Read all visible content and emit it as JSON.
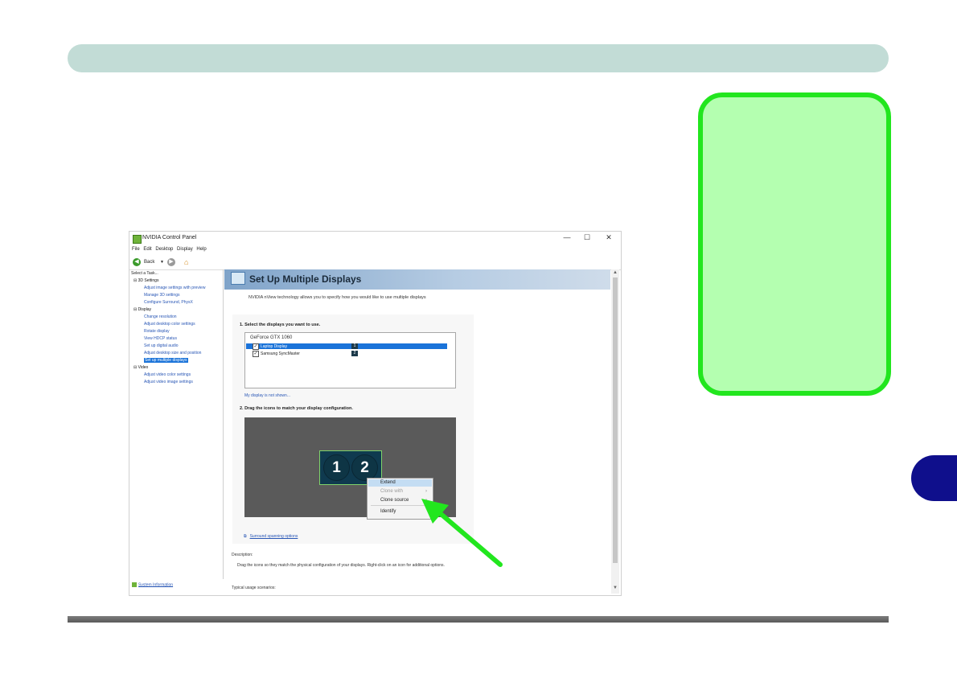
{
  "window": {
    "title": "NVIDIA Control Panel",
    "minimize": "—",
    "maximize": "☐",
    "close": "✕"
  },
  "menu": [
    "File",
    "Edit",
    "Desktop",
    "Display",
    "Help"
  ],
  "toolbar": {
    "back_label": "Back"
  },
  "sidebar": {
    "select_task": "Select a Task...",
    "tree": [
      {
        "label": "3D Settings",
        "kind": "category"
      },
      {
        "label": "Adjust image settings with preview",
        "kind": "link"
      },
      {
        "label": "Manage 3D settings",
        "kind": "link"
      },
      {
        "label": "Configure Surround, PhysX",
        "kind": "link"
      },
      {
        "label": "Display",
        "kind": "category"
      },
      {
        "label": "Change resolution",
        "kind": "link"
      },
      {
        "label": "Adjust desktop color settings",
        "kind": "link"
      },
      {
        "label": "Rotate display",
        "kind": "link"
      },
      {
        "label": "View HDCP status",
        "kind": "link"
      },
      {
        "label": "Set up digital audio",
        "kind": "link"
      },
      {
        "label": "Adjust desktop size and position",
        "kind": "link"
      },
      {
        "label": "Set up multiple displays",
        "kind": "selected"
      },
      {
        "label": "Video",
        "kind": "category"
      },
      {
        "label": "Adjust video color settings",
        "kind": "link"
      },
      {
        "label": "Adjust video image settings",
        "kind": "link"
      }
    ],
    "system_information": "System Information"
  },
  "page": {
    "title": "Set Up Multiple Displays",
    "intro": "NVIDIA nView technology allows you to specify how you would like to use multiple displays",
    "step1": "1. Select the displays you want to use.",
    "gpu_name": "GeForce GTX 1060",
    "displays": [
      {
        "name": "Laptop Display",
        "number": "1",
        "checked": true,
        "selected": true
      },
      {
        "name": "Samsung SyncMaster",
        "number": "2",
        "checked": true,
        "selected": false
      }
    ],
    "not_shown": "My display is not shown...",
    "step2": "2. Drag the icons to match your display configuration.",
    "monitors": [
      "1",
      "2"
    ],
    "context_menu": [
      {
        "label": "Extend",
        "state": "highlighted"
      },
      {
        "label": "Clone with",
        "state": "disabled",
        "submenu": true
      },
      {
        "label": "Clone source",
        "state": "normal",
        "submenu": true
      },
      {
        "label": "Identify",
        "state": "normal"
      }
    ],
    "surround_link": "Surround spanning options",
    "description_label": "Description:",
    "description_text": "Drag the icons so they match the physical configuration of your displays. Right-click on an icon for additional options.",
    "typical_usage": "Typical usage scenarios:"
  },
  "colors": {
    "top_bar": "#c2dcd6",
    "side_box_fill": "#b4ffb0",
    "side_box_border": "#22e61e",
    "chapter_tab": "#0f0f8c",
    "arrow": "#22e61e",
    "selection": "#1a73d9"
  }
}
